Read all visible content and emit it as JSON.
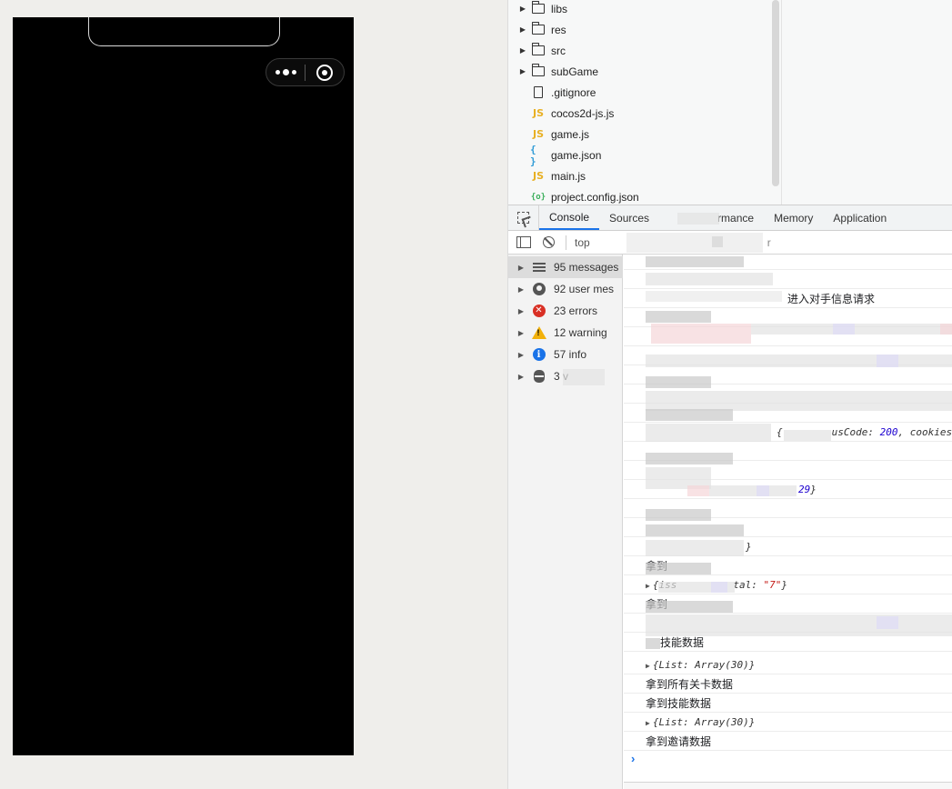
{
  "simulator": {
    "menu_icon": "more-dots-icon",
    "close_icon": "target-circle-icon"
  },
  "file_tree": {
    "items": [
      {
        "name": "libs",
        "kind": "folder"
      },
      {
        "name": "res",
        "kind": "folder"
      },
      {
        "name": "src",
        "kind": "folder"
      },
      {
        "name": "subGame",
        "kind": "folder"
      },
      {
        "name": ".gitignore",
        "kind": "file"
      },
      {
        "name": "cocos2d-js.js",
        "kind": "js",
        "badge": "JS"
      },
      {
        "name": "game.js",
        "kind": "js",
        "badge": "JS"
      },
      {
        "name": "game.json",
        "kind": "json",
        "badge": "{ }"
      },
      {
        "name": "main.js",
        "kind": "js",
        "badge": "JS"
      },
      {
        "name": "project.config.json",
        "kind": "cfg",
        "badge": "{o}"
      }
    ]
  },
  "devtools": {
    "tabs": [
      "Console",
      "Sources",
      "rmance",
      "Memory",
      "Application"
    ],
    "active_tab": "Console",
    "context": "top",
    "toolbar_fragment": "r"
  },
  "console_sidebar": {
    "items": [
      {
        "label": "95 messages",
        "icon": "list-icon",
        "selected": true
      },
      {
        "label": "92 user mes",
        "icon": "user-icon",
        "selected": false
      },
      {
        "label": "23 errors",
        "icon": "error-icon",
        "selected": false
      },
      {
        "label": "12 warning",
        "icon": "warning-icon",
        "selected": false
      },
      {
        "label": "57 info",
        "icon": "info-icon",
        "selected": false
      },
      {
        "label": "3 v",
        "icon": "bug-icon",
        "selected": false
      }
    ]
  },
  "console_log": {
    "line_enter_opponent": "进入对手信息请求",
    "line_status_prefix": "{",
    "line_status_key": "usCode: ",
    "line_status_val": "200",
    "line_status_tail": ", cookies:",
    "line_count_val": "29",
    "line_count_tail": "}",
    "line_brace": "}",
    "line_got_prefix": "拿到",
    "line_obj_prefix": "{iss",
    "line_obj_key": "tal: ",
    "line_obj_val": "\"7\"",
    "line_obj_tail": "}",
    "line_got_short": "拿到",
    "line_skill_partial": "技能数据",
    "line_list_a": "{List: Array(30)}",
    "line_all_levels": "拿到所有关卡数据",
    "line_skill": "拿到技能数据",
    "line_list_b": "{List: Array(30)}",
    "line_invite": "拿到邀请数据"
  }
}
